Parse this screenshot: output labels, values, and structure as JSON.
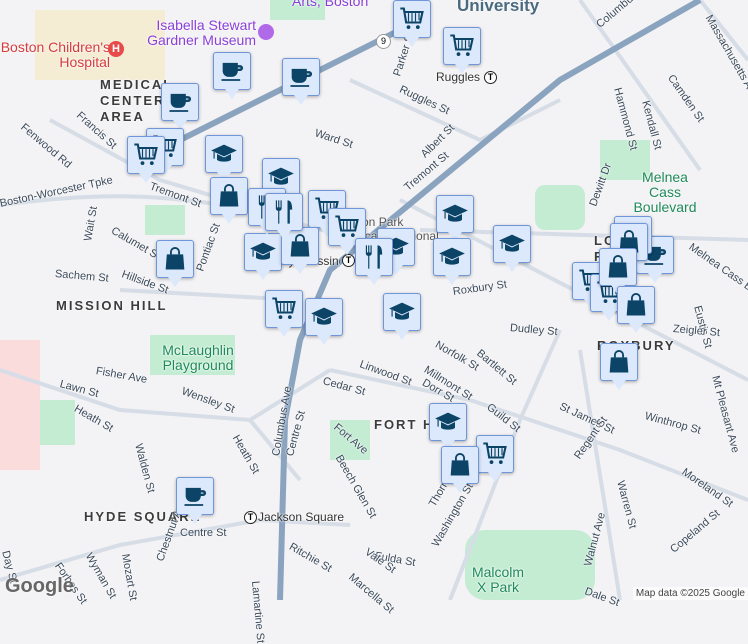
{
  "map": {
    "neighborhoods": [
      "MEDICAL CENTER AREA",
      "MISSION HILL",
      "FORT HILL",
      "HYDE SQUARE",
      "LOWER ROXBURY",
      "ROXBURY"
    ],
    "places": {
      "hospital": "Boston Children's Hospital",
      "museum": "Isabella Stewart Gardner Museum",
      "mfa": "Arts, Boston",
      "university": "University",
      "playground": "McLaughlin Playground",
      "melnea": "Melnea Cass Boulevard",
      "malcolm": "Malcolm X Park",
      "school": "Madison Park Technical Vocational High School"
    },
    "stations": [
      "Ruggles",
      "Roxbury Crossing",
      "Jackson Square"
    ],
    "route_shield": "9",
    "streets": [
      "Fenwood Rd",
      "Francis St",
      "Boston-Worcester Tpke",
      "Tremont St",
      "Wait St",
      "Calumet St",
      "Hillside St",
      "Sachem St",
      "Pontiac St",
      "Ward St",
      "Parker St",
      "Ruggles St",
      "Albert St",
      "Tremont St",
      "Columbus Ave",
      "Massachusetts Ave",
      "Camden St",
      "Hammond St",
      "Kendall St",
      "Dewitt Dr",
      "Melnea Cass Blvd",
      "Eustis St",
      "Zeigler St",
      "Dudley St",
      "Roxbury St",
      "Norfolk St",
      "Bartlett St",
      "Linwood St",
      "Millmont St",
      "Dorr St",
      "Guild St",
      "St James St",
      "Winthrop St",
      "Regent St",
      "Moreland St",
      "Warren St",
      "Walnut Ave",
      "Mt Pleasant Ave",
      "Copeland St",
      "Dale St",
      "Washington St",
      "Thornton St",
      "Fulda St",
      "Vale St",
      "Marcella St",
      "Beech Glen St",
      "Fort Ave",
      "Centre St",
      "Cedar St",
      "Columbus Ave",
      "Heath St",
      "Wensley St",
      "Fisher Ave",
      "Lawn St",
      "Heath St",
      "Walden St",
      "Centre St",
      "Chestnut Ave",
      "Mozart St",
      "Wyman St",
      "Forbes St",
      "Day St",
      "Ritchie St",
      "Lamartine St"
    ],
    "markers": [
      {
        "type": "coffee"
      },
      {
        "type": "coffee"
      },
      {
        "type": "coffee"
      },
      {
        "type": "coffee"
      },
      {
        "type": "coffee"
      },
      {
        "type": "cart"
      },
      {
        "type": "cart"
      },
      {
        "type": "cart"
      },
      {
        "type": "cart"
      },
      {
        "type": "cart"
      },
      {
        "type": "cart"
      },
      {
        "type": "cart"
      },
      {
        "type": "cart"
      },
      {
        "type": "cart"
      },
      {
        "type": "cart"
      },
      {
        "type": "school"
      },
      {
        "type": "school"
      },
      {
        "type": "school"
      },
      {
        "type": "school"
      },
      {
        "type": "school"
      },
      {
        "type": "school"
      },
      {
        "type": "school"
      },
      {
        "type": "school"
      },
      {
        "type": "school"
      },
      {
        "type": "school"
      },
      {
        "type": "shopping"
      },
      {
        "type": "shopping"
      },
      {
        "type": "shopping"
      },
      {
        "type": "shopping"
      },
      {
        "type": "shopping"
      },
      {
        "type": "shopping"
      },
      {
        "type": "shopping"
      },
      {
        "type": "shopping"
      },
      {
        "type": "shopping"
      },
      {
        "type": "restaurant"
      },
      {
        "type": "restaurant"
      },
      {
        "type": "restaurant"
      }
    ],
    "attribution": "Map data ©2025 Google",
    "logo": "Google"
  },
  "colors": {
    "marker_bg": "#dce8fb",
    "marker_border": "#6f96d8",
    "icon": "#0b4466",
    "highway": "#8aa3bf",
    "park": "#c4ecd3"
  }
}
